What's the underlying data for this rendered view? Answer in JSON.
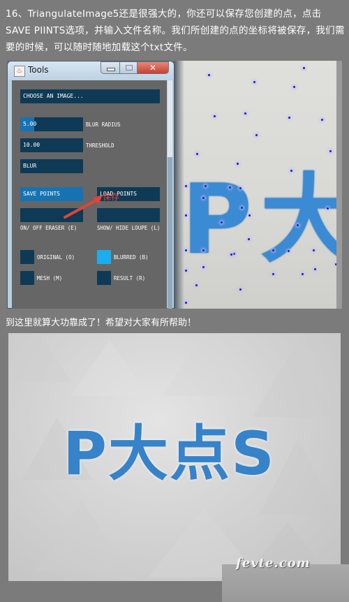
{
  "intro_text": "16、TriangulateImage5还是很强大的，你还可以保存您创建的点，点击SAVE PIINTS选项，并输入文件名称。我们所创建的点的坐标将被保存，我们需要的时候，可以随时随地加载这个txt文件。",
  "tools_window": {
    "title": "Tools",
    "app_icon": "java-icon",
    "controls": {
      "minimize": "minimize-icon",
      "maximize": "maximize-icon",
      "close": "✕"
    },
    "choose_image_label": "CHOOSE AN IMAGE...",
    "blur_radius": {
      "value": "5.00",
      "label": "BLUR RADIUS",
      "fill_fraction": 0.22
    },
    "threshold": {
      "value": "10.00",
      "label": "THRESHOLD"
    },
    "blur_button": "BLUR",
    "save_points": "SAVE POINTS",
    "load_points": "LOAD POINTS",
    "eraser_label": "ON/ OFF ERASER (E)",
    "loupe_label": "SHOW/ HIDE LOUPE (L)",
    "view_options": [
      {
        "label": "ORIGINAL (O)",
        "checked": false
      },
      {
        "label": "BLURRED (B)",
        "checked": true
      },
      {
        "label": "MESH (M)",
        "checked": false
      },
      {
        "label": "RESULT (R)",
        "checked": false
      }
    ]
  },
  "annotation_text": "保存",
  "preview_letters": "P大",
  "caption_text": "到这里就算大功靠成了！希望对大家有所帮助！",
  "result_text": "P大点S",
  "watermark": "fevte.com",
  "colors": {
    "panel_bg": "#666666",
    "field_bg": "#0e3a55",
    "accent_blue": "#1673b3",
    "checked_blue": "#19aef0",
    "letters_blue": "#3683c9",
    "annotation_red": "#e0443a"
  }
}
